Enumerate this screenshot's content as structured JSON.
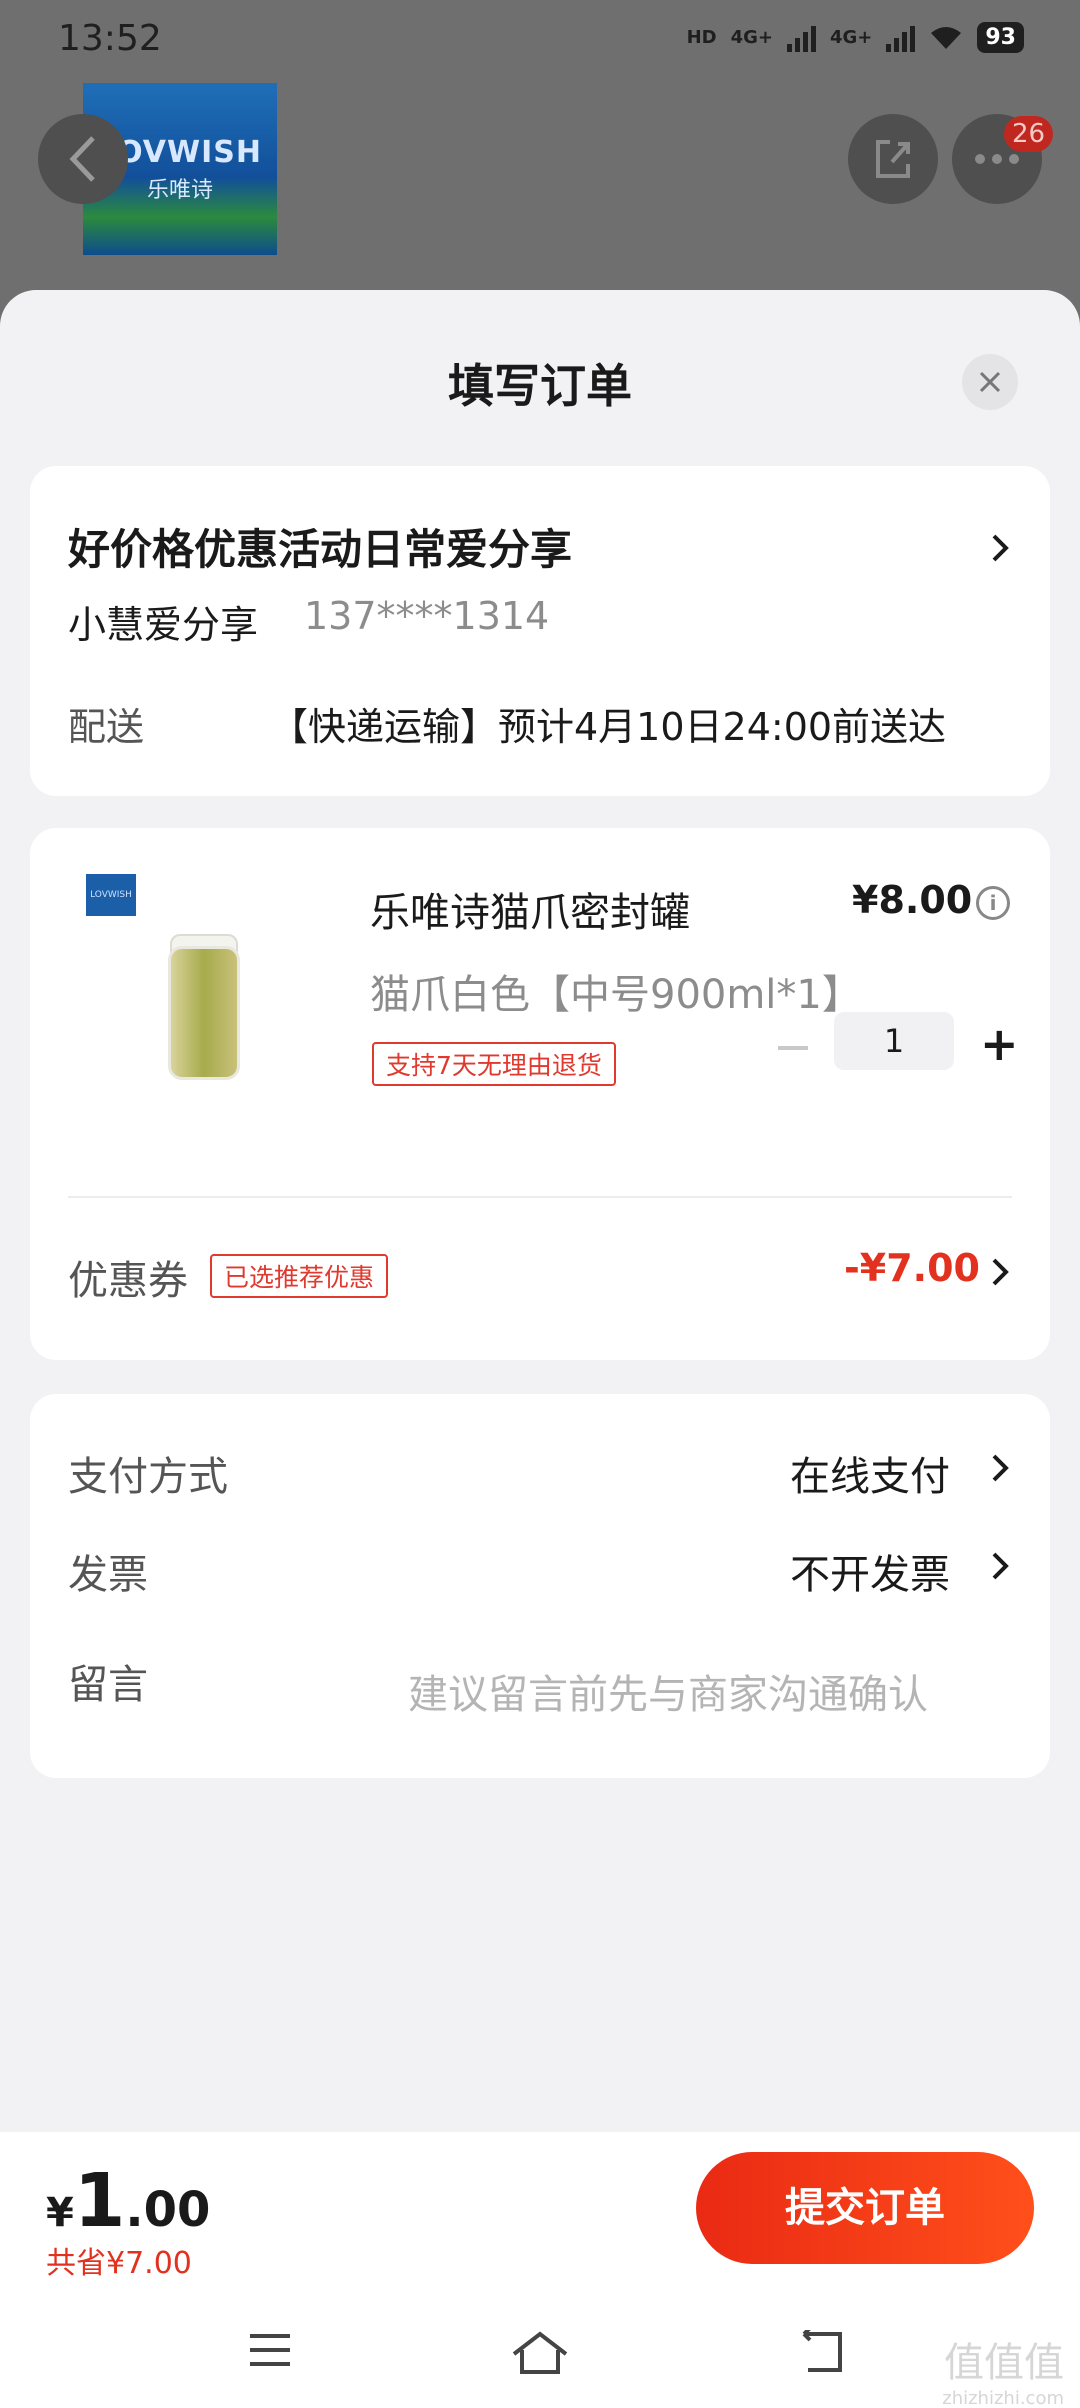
{
  "status_bar": {
    "time": "13:52",
    "network_1": "HD",
    "net_a": "4G+",
    "net_b": "4G+",
    "battery": "93"
  },
  "background": {
    "brand_line1": "LOVWISH",
    "brand_line2": "乐唯诗",
    "badge_count": "26"
  },
  "sheet": {
    "title": "填写订单"
  },
  "address": {
    "title": "好价格优惠活动日常爱分享",
    "name": "小慧爱分享",
    "phone": "137****1314",
    "shipping_label": "配送",
    "shipping_value": "【快递运输】预计4月10日24:00前送达"
  },
  "product": {
    "name": "乐唯诗猫爪密封罐",
    "price": "¥8.00",
    "spec": "猫爪白色【中号900ml*1】",
    "return_tag": "支持7天无理由退货",
    "quantity": "1"
  },
  "coupon": {
    "label": "优惠券",
    "tag": "已选推荐优惠",
    "value": "-¥7.00"
  },
  "payment": {
    "method_label": "支付方式",
    "method_value": "在线支付",
    "invoice_label": "发票",
    "invoice_value": "不开发票",
    "note_label": "留言",
    "note_placeholder": "建议留言前先与商家沟通确认"
  },
  "footer": {
    "currency": "¥",
    "total_int": "1",
    "total_dec": ".00",
    "saved": "共省¥7.00",
    "submit_label": "提交订单"
  },
  "watermark": {
    "text": "值值值",
    "url": "zhizhizhi.com"
  },
  "colors": {
    "accent": "#e2321f",
    "submit_gradient_start": "#ea2a14",
    "submit_gradient_end": "#ff4f1a"
  }
}
